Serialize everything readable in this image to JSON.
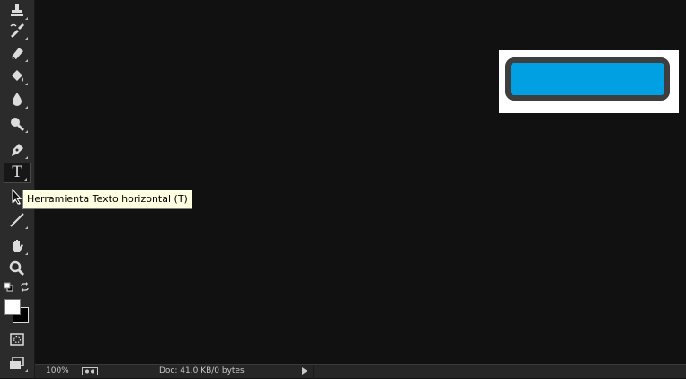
{
  "toolbar": {
    "tools": [
      {
        "icon": "stamp-icon"
      },
      {
        "icon": "history-brush-icon"
      },
      {
        "icon": "eraser-icon"
      },
      {
        "icon": "paint-bucket-icon"
      },
      {
        "icon": "blur-icon"
      },
      {
        "icon": "dodge-icon"
      },
      {
        "icon": "pen-icon"
      },
      {
        "icon": "horizontal-type-icon",
        "glyph": "T",
        "selected": true
      },
      {
        "icon": "path-selection-icon"
      },
      {
        "icon": "line-icon"
      },
      {
        "icon": "hand-icon"
      },
      {
        "icon": "zoom-icon"
      }
    ],
    "foreground_color": "#ffffff",
    "background_color": "#000000"
  },
  "tooltip": {
    "text": "Herramienta Texto horizontal (T)"
  },
  "canvas": {
    "doc_background": "#ffffff",
    "shape_fill": "#00a0e3",
    "shape_stroke": "#3e3e3e"
  },
  "statusbar": {
    "zoom": "100%",
    "doc_info": "Doc: 41.0 KB/0 bytes"
  }
}
